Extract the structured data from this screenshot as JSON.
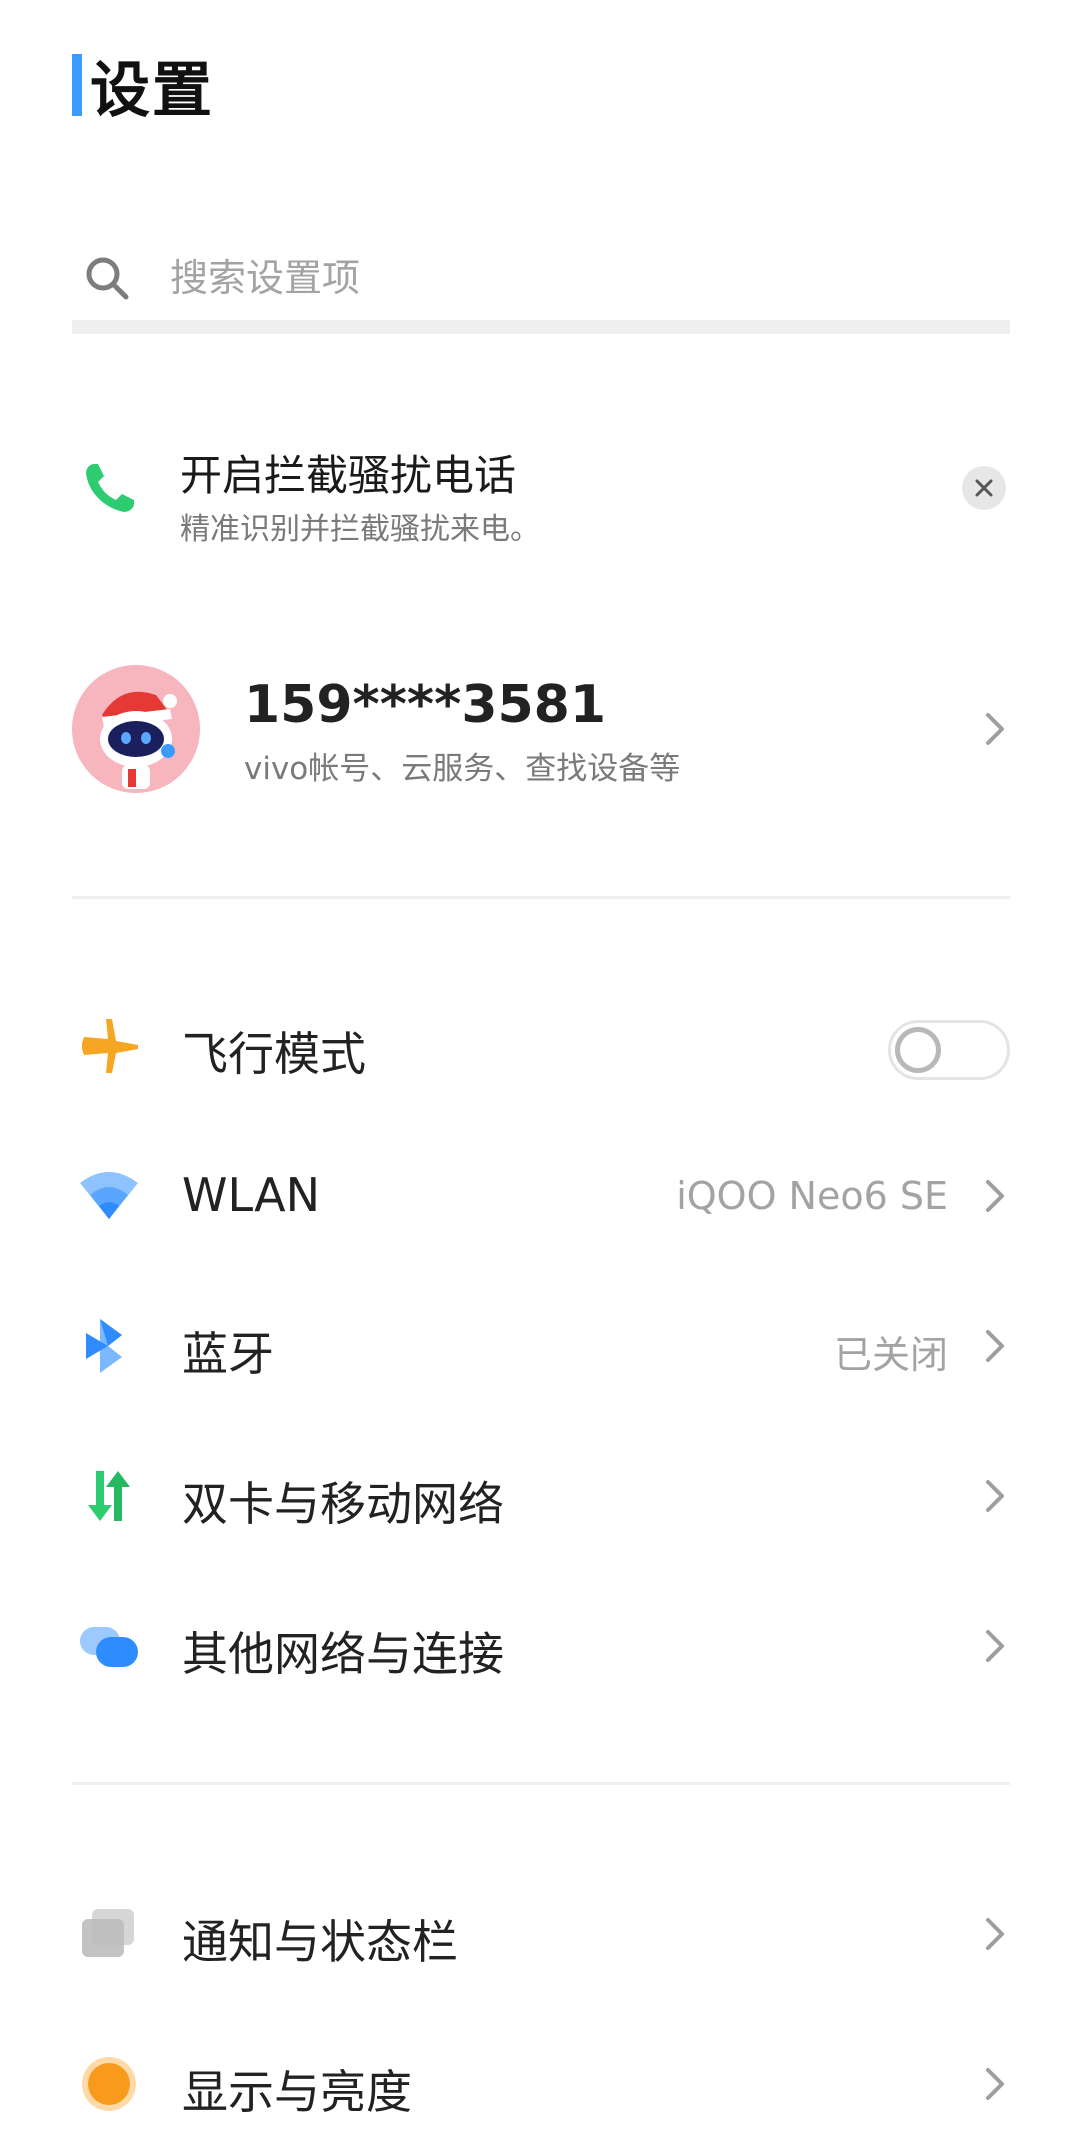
{
  "header": {
    "title": "设置"
  },
  "search": {
    "placeholder": "搜索设置项"
  },
  "promo": {
    "title": "开启拦截骚扰电话",
    "subtitle": "精准识别并拦截骚扰来电。"
  },
  "account": {
    "number": "159****3581",
    "subtitle": "vivo帐号、云服务、查找设备等"
  },
  "connectivity": {
    "airplane": {
      "label": "飞行模式",
      "toggle_on": false
    },
    "wlan": {
      "label": "WLAN",
      "value": "iQOO Neo6 SE"
    },
    "bluetooth": {
      "label": "蓝牙",
      "value": "已关闭"
    },
    "sim": {
      "label": "双卡与移动网络"
    },
    "other": {
      "label": "其他网络与连接"
    }
  },
  "system": {
    "notifications": {
      "label": "通知与状态栏"
    },
    "display": {
      "label": "显示与亮度"
    }
  },
  "colors": {
    "accent": "#3d9bff",
    "phone_icon": "#2ecc71",
    "airplane_icon": "#f6a623",
    "wifi_icon": "#2f8cff",
    "bluetooth_icon": "#2f8cff",
    "sim_icon": "#2ecc71",
    "display_icon": "#f89a1c"
  }
}
